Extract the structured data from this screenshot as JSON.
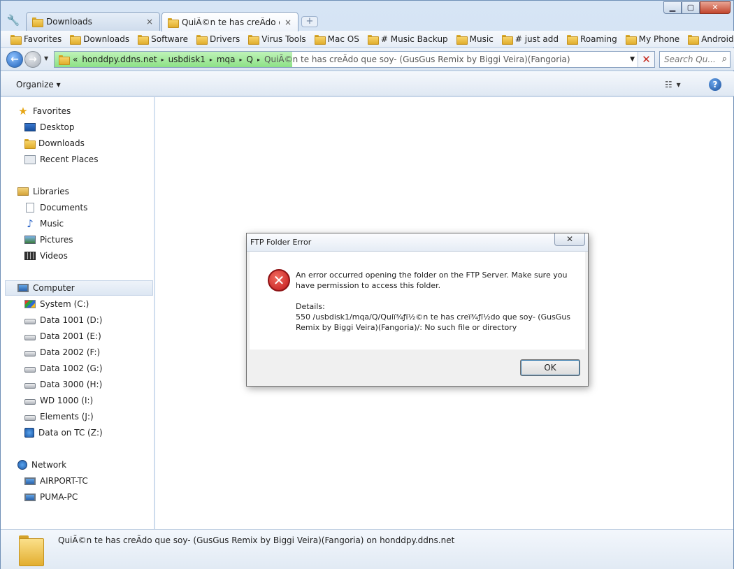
{
  "tabs": [
    {
      "label": "Downloads",
      "close": "×"
    },
    {
      "label": "QuiÃ©n te has creÃ­do que soy- (GusGus Remix by Biggi Veira)(Fangoria)",
      "close": "×"
    }
  ],
  "new_tab_symbol": "+",
  "window_controls": {
    "minimize": "▁",
    "maximize": "▢",
    "close": "✕"
  },
  "bookmarks": [
    "Favorites",
    "Downloads",
    "Software",
    "Drivers",
    "Virus Tools",
    "Mac OS",
    "# Music Backup",
    "Music",
    "# just add",
    "Roaming",
    "My Phone",
    "Android"
  ],
  "address": {
    "prefix": "«",
    "crumbs": [
      "honddpy.ddns.net",
      "usbdisk1",
      "mqa",
      "Q",
      "QuiÃ©n te has creÃ­do que soy- (GusGus Remix by Biggi Veira)(Fangoria)"
    ],
    "separator": "▸",
    "clear": "✕"
  },
  "search": {
    "placeholder": "Search Qu..."
  },
  "commandbar": {
    "organize": "Organize ▾",
    "view": "☷ ▾",
    "help": "?"
  },
  "navpane": {
    "favorites": {
      "label": "Favorites",
      "items": [
        "Desktop",
        "Downloads",
        "Recent Places"
      ]
    },
    "libraries": {
      "label": "Libraries",
      "items": [
        "Documents",
        "Music",
        "Pictures",
        "Videos"
      ]
    },
    "computer": {
      "label": "Computer",
      "items": [
        "System (C:)",
        "Data 1001 (D:)",
        "Data 2001 (E:)",
        "Data 2002 (F:)",
        "Data 1002 (G:)",
        "Data 3000 (H:)",
        "WD 1000 (I:)",
        "Elements (J:)",
        "Data on TC (Z:)"
      ]
    },
    "network": {
      "label": "Network",
      "items": [
        "AIRPORT-TC",
        "PUMA-PC"
      ]
    }
  },
  "details": {
    "text": "QuiÃ©n te has creÃ­do que soy- (GusGus Remix by Biggi Veira)(Fangoria) on honddpy.ddns.net"
  },
  "dialog": {
    "title": "FTP Folder Error",
    "close": "✕",
    "message": "An error occurred opening the folder on the FTP Server.  Make sure you have permission to access this folder.",
    "details_label": "Details:",
    "details_text": "550 /usbdisk1/mqa/Q/Quiï¾ƒï½©n te has creï¾ƒï½­do que soy- (GusGus Remix by Biggi Veira)(Fangoria)/: No such file or directory",
    "error_symbol": "✕",
    "ok_label": "OK"
  }
}
